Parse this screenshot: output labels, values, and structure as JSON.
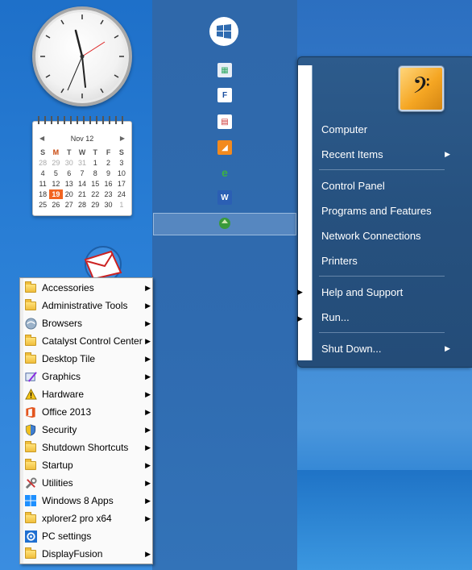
{
  "calendar": {
    "month_label": "Nov 12",
    "weekdays": [
      "S",
      "M",
      "T",
      "W",
      "T",
      "F",
      "S"
    ],
    "weeks": [
      [
        "28",
        "29",
        "30",
        "31",
        "1",
        "2",
        "3"
      ],
      [
        "4",
        "5",
        "6",
        "7",
        "8",
        "9",
        "10"
      ],
      [
        "11",
        "12",
        "13",
        "14",
        "15",
        "16",
        "17"
      ],
      [
        "18",
        "19",
        "20",
        "21",
        "22",
        "23",
        "24"
      ],
      [
        "25",
        "26",
        "27",
        "28",
        "29",
        "30",
        "1"
      ]
    ],
    "today": "19"
  },
  "all_programs": {
    "items": [
      {
        "label": "Accessories",
        "icon": "folder-icon",
        "submenu": true
      },
      {
        "label": "Administrative Tools",
        "icon": "folder-icon",
        "submenu": true
      },
      {
        "label": "Browsers",
        "icon": "browser-icon",
        "submenu": true
      },
      {
        "label": "Catalyst Control Center",
        "icon": "folder-icon",
        "submenu": true
      },
      {
        "label": "Desktop Tile",
        "icon": "folder-icon",
        "submenu": true
      },
      {
        "label": "Graphics",
        "icon": "graphics-icon",
        "submenu": true
      },
      {
        "label": "Hardware",
        "icon": "warning-icon",
        "submenu": true
      },
      {
        "label": "Office 2013",
        "icon": "office-icon",
        "submenu": true
      },
      {
        "label": "Security",
        "icon": "shield-icon",
        "submenu": true
      },
      {
        "label": "Shutdown Shortcuts",
        "icon": "folder-icon",
        "submenu": true
      },
      {
        "label": "Startup",
        "icon": "folder-icon",
        "submenu": true
      },
      {
        "label": "Utilities",
        "icon": "tools-icon",
        "submenu": true
      },
      {
        "label": "Windows 8 Apps",
        "icon": "windows-icon",
        "submenu": true
      },
      {
        "label": "xplorer2 pro x64",
        "icon": "folder-icon",
        "submenu": true
      },
      {
        "label": "PC settings",
        "icon": "gear-icon",
        "submenu": false
      },
      {
        "label": "DisplayFusion",
        "icon": "folder-icon",
        "submenu": true
      }
    ]
  },
  "start_menu": {
    "items": [
      {
        "label": "Computer",
        "submenu": false
      },
      {
        "label": "Recent Items",
        "submenu": true
      },
      {
        "label": "Control Panel",
        "submenu": false
      },
      {
        "label": "Programs and Features",
        "submenu": false
      },
      {
        "label": "Network Connections",
        "submenu": false
      },
      {
        "label": "Printers",
        "submenu": false
      },
      {
        "label": "Help and Support",
        "submenu": false
      },
      {
        "label": "Run...",
        "submenu": false
      },
      {
        "label": "Shut Down...",
        "submenu": true
      }
    ]
  },
  "colors": {
    "accent_today": "#f26522",
    "start_menu_bg": "#26517f",
    "start_strip_bg": "#2f6bb0"
  }
}
